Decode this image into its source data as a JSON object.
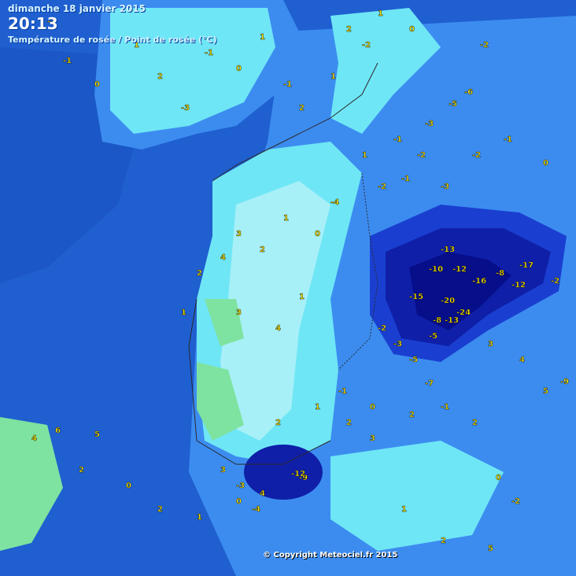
{
  "header": {
    "date": "dimanche 18 janvier 2015",
    "time": "20:13",
    "title": "Température de rosée / Point de rosée (°C)"
  },
  "copyright": "© Copyright Meteociel.fr 2015",
  "colors": {
    "sea": "#1f5fd0",
    "deep": "#0d2fb5",
    "mid": "#3c8cf0",
    "land_light": "#6fe6f5",
    "pale": "#a8f0f8",
    "green": "#7ee3a0",
    "cold_core": "#0f1fa8",
    "cold_darkest": "#070e8a",
    "value_color": "#ffe800"
  },
  "stations": [
    {
      "v": "-2"
    },
    {
      "v": "-1"
    },
    {
      "v": "0"
    },
    {
      "v": "1"
    },
    {
      "v": "2"
    },
    {
      "v": "-3"
    },
    {
      "v": "-1"
    },
    {
      "v": "0"
    },
    {
      "v": "1"
    },
    {
      "v": "-1"
    },
    {
      "v": "2"
    },
    {
      "v": "1"
    },
    {
      "v": "-2"
    },
    {
      "v": "-6"
    },
    {
      "v": "-5"
    },
    {
      "v": "-3"
    },
    {
      "v": "-2"
    },
    {
      "v": "0"
    },
    {
      "v": "1"
    },
    {
      "v": "2"
    },
    {
      "v": "-1"
    },
    {
      "v": "-2"
    },
    {
      "v": "1"
    },
    {
      "v": "-4"
    },
    {
      "v": "-2"
    },
    {
      "v": "-1"
    },
    {
      "v": "-3"
    },
    {
      "v": "-2"
    },
    {
      "v": "-1"
    },
    {
      "v": "0"
    },
    {
      "v": "3"
    },
    {
      "v": "4"
    },
    {
      "v": "2"
    },
    {
      "v": "1"
    },
    {
      "v": "0"
    },
    {
      "v": "2"
    },
    {
      "v": "1"
    },
    {
      "v": "3"
    },
    {
      "v": "4"
    },
    {
      "v": "1"
    },
    {
      "v": "-13"
    },
    {
      "v": "-10"
    },
    {
      "v": "-12"
    },
    {
      "v": "-15"
    },
    {
      "v": "-20"
    },
    {
      "v": "-24"
    },
    {
      "v": "-8"
    },
    {
      "v": "-13"
    },
    {
      "v": "-16"
    },
    {
      "v": "-5"
    },
    {
      "v": "-3"
    },
    {
      "v": "-2"
    },
    {
      "v": "-5"
    },
    {
      "v": "-7"
    },
    {
      "v": "-9"
    },
    {
      "v": "-12"
    },
    {
      "v": "-17"
    },
    {
      "v": "-8"
    },
    {
      "v": "-12"
    },
    {
      "v": "-2"
    },
    {
      "v": "6"
    },
    {
      "v": "5"
    },
    {
      "v": "4"
    },
    {
      "v": "2"
    },
    {
      "v": "0"
    },
    {
      "v": "2"
    },
    {
      "v": "1"
    },
    {
      "v": "0"
    },
    {
      "v": "4"
    },
    {
      "v": "3"
    },
    {
      "v": "2"
    },
    {
      "v": "1"
    },
    {
      "v": "-1"
    },
    {
      "v": "2"
    },
    {
      "v": "0"
    },
    {
      "v": "-3"
    },
    {
      "v": "-4"
    },
    {
      "v": "3"
    },
    {
      "v": "2"
    },
    {
      "v": "-1"
    },
    {
      "v": "3"
    },
    {
      "v": "4"
    },
    {
      "v": "5"
    },
    {
      "v": "2"
    },
    {
      "v": "0"
    },
    {
      "v": "-2"
    },
    {
      "v": "-9"
    },
    {
      "v": "5"
    },
    {
      "v": "2"
    },
    {
      "v": "1"
    }
  ]
}
